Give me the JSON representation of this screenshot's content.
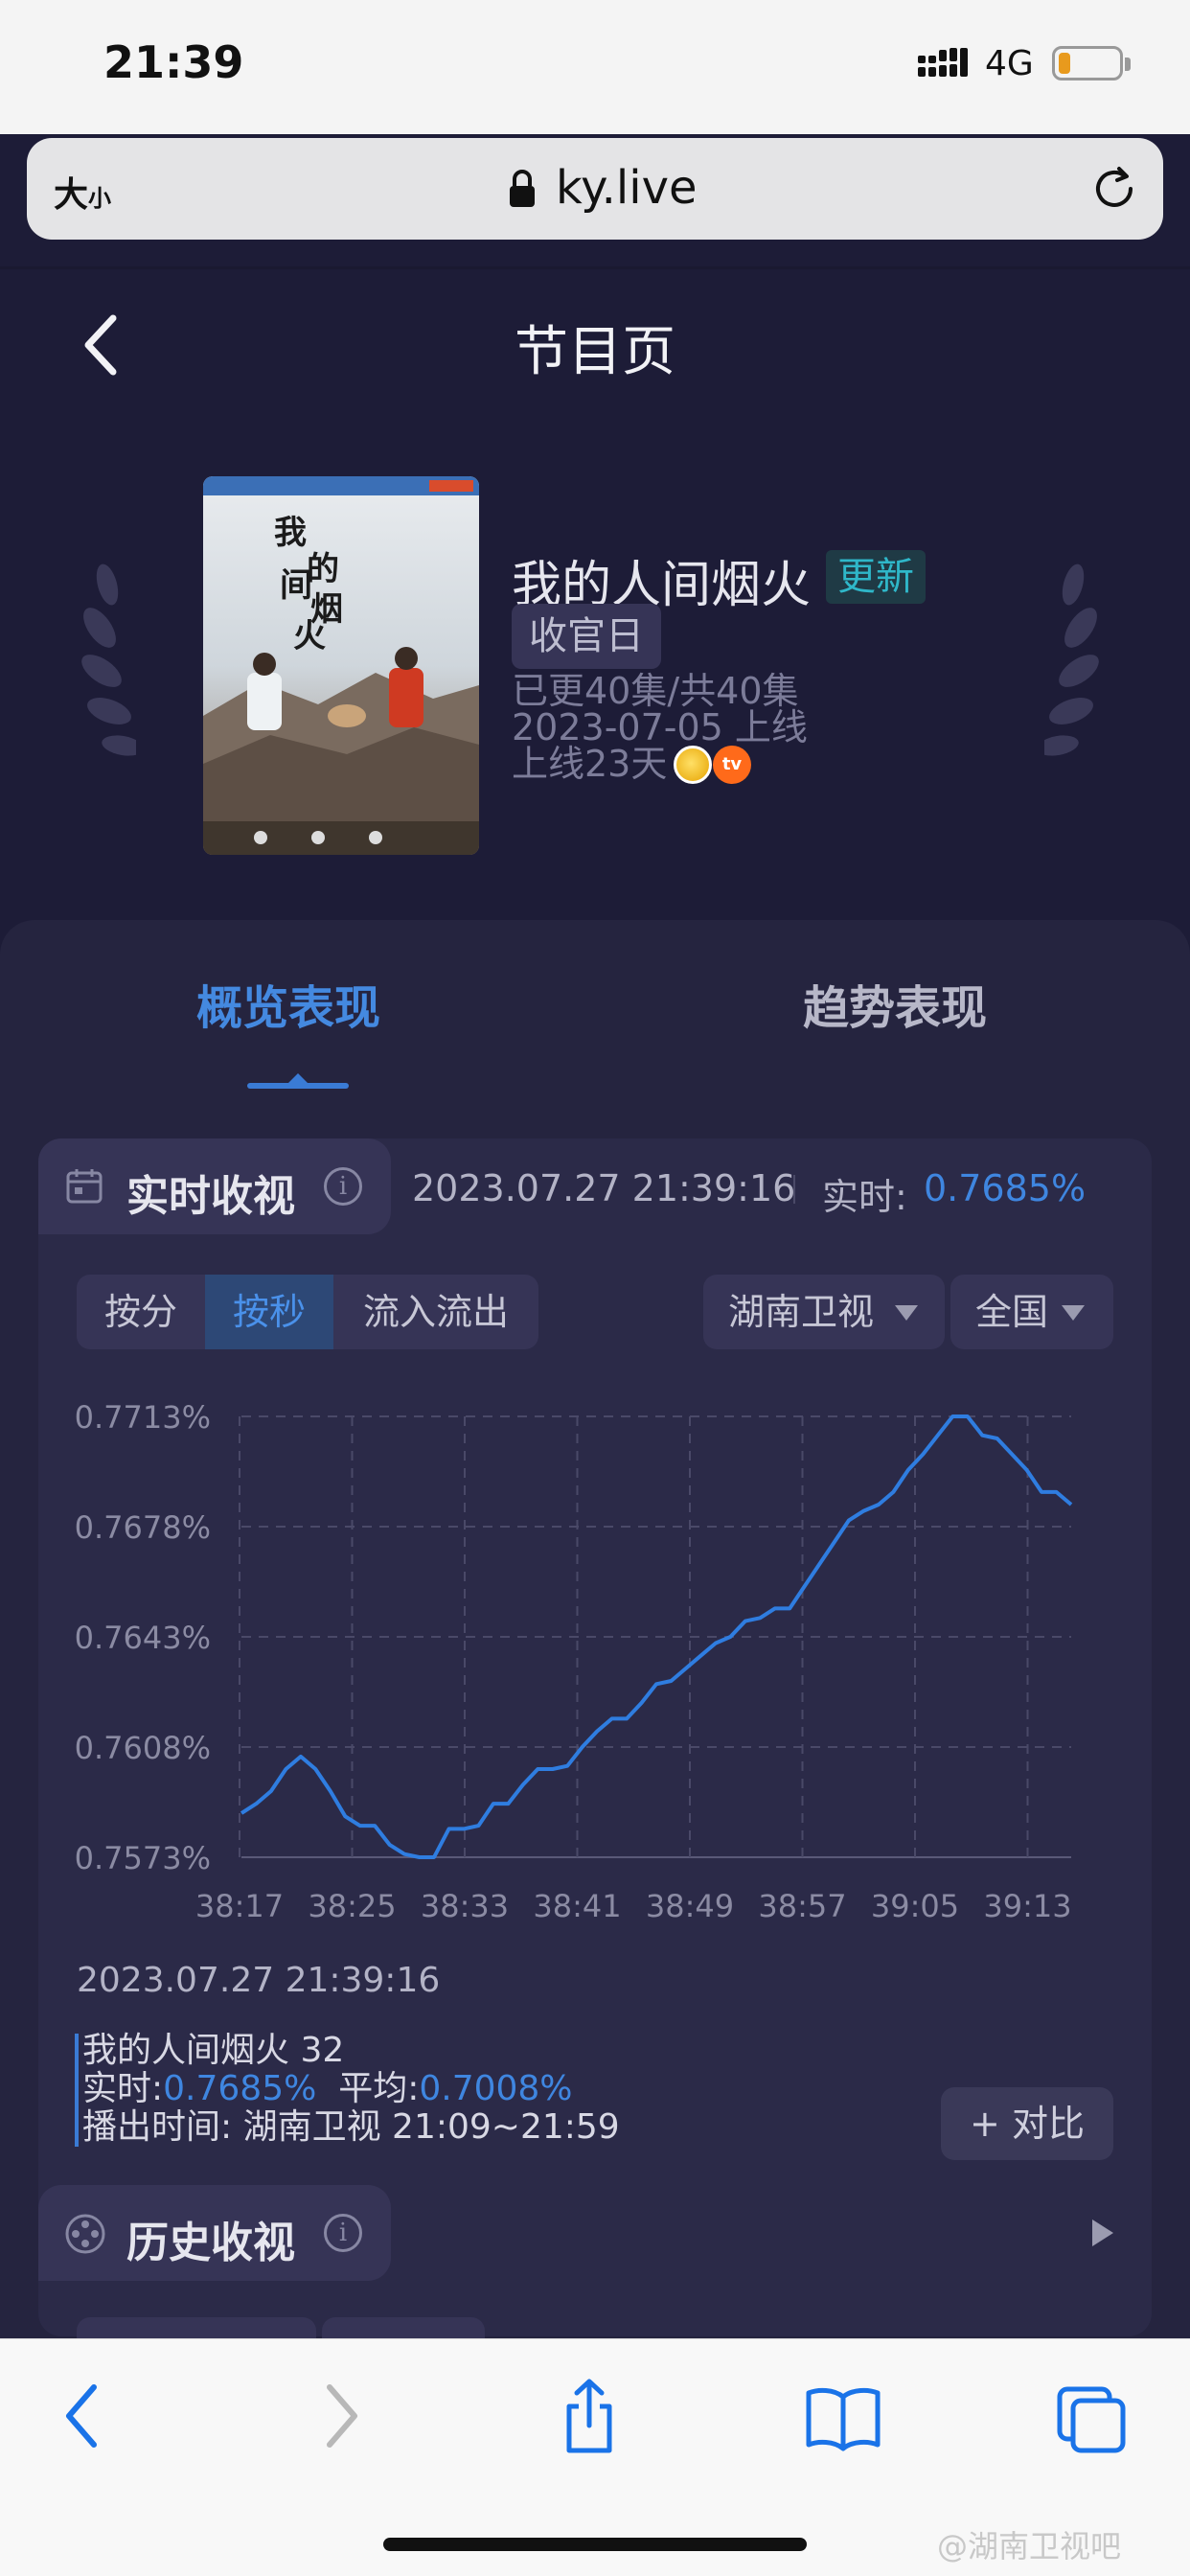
{
  "status_bar": {
    "time": "21:39",
    "network": "4G"
  },
  "url_bar": {
    "size_label": "大",
    "size_small": "小",
    "url": "ky.live"
  },
  "header": {
    "title": "节目页"
  },
  "program": {
    "title": "我的人间烟火",
    "badge": "更新",
    "tag": "收官日",
    "episodes": "已更40集/共40集",
    "launch_date": "2023-07-05 上线",
    "online_days": "上线23天",
    "poster_title": "我的人间烟火"
  },
  "tabs": [
    {
      "label": "概览表现",
      "active": true
    },
    {
      "label": "趋势表现",
      "active": false
    }
  ],
  "realtime": {
    "section_title": "实时收视",
    "timestamp": "2023.07.27 21:39:16",
    "label": "实时:",
    "value": "0.7685%"
  },
  "controls": {
    "segments": [
      {
        "label": "按分",
        "active": false
      },
      {
        "label": "按秒",
        "active": true
      },
      {
        "label": "流入流出",
        "active": false
      }
    ],
    "channel": "湖南卫视",
    "region": "全国"
  },
  "chart_data": {
    "type": "line",
    "x_ticks": [
      "38:17",
      "38:25",
      "38:33",
      "38:41",
      "38:49",
      "38:57",
      "39:05",
      "39:13"
    ],
    "y_ticks": [
      "0.7713%",
      "0.7678%",
      "0.7643%",
      "0.7608%",
      "0.7573%"
    ],
    "ylim": [
      0.7573,
      0.7713
    ],
    "grid": true,
    "x": [
      0,
      1.5,
      3,
      4,
      5,
      6,
      7,
      8,
      9,
      10,
      11,
      12,
      13,
      14,
      15,
      16,
      17,
      18,
      19,
      20,
      21,
      22,
      23,
      24,
      25,
      26,
      27,
      28,
      29,
      30,
      31,
      32,
      33,
      34,
      35,
      36,
      37,
      38,
      39,
      40,
      41,
      42,
      43,
      44,
      45,
      46,
      47,
      48,
      49,
      50,
      51,
      52,
      53,
      54,
      55,
      56,
      57,
      58,
      59,
      60,
      61,
      62,
      63,
      64
    ],
    "values": [
      0.7587,
      0.759,
      0.7594,
      0.7601,
      0.7605,
      0.7601,
      0.7594,
      0.7586,
      0.7583,
      0.7583,
      0.7577,
      0.7574,
      0.7573,
      0.7573,
      0.7582,
      0.7582,
      0.7583,
      0.759,
      0.759,
      0.7596,
      0.7601,
      0.7601,
      0.7602,
      0.7608,
      0.7613,
      0.7617,
      0.7617,
      0.7622,
      0.7628,
      0.7629,
      0.7633,
      0.7637,
      0.7641,
      0.7643,
      0.7648,
      0.7649,
      0.7652,
      0.7652,
      0.7659,
      0.7666,
      0.7673,
      0.768,
      0.7683,
      0.7685,
      0.7689,
      0.7696,
      0.7701,
      0.7707,
      0.7713,
      0.7713,
      0.7707,
      0.7706,
      0.7701,
      0.7696,
      0.7689,
      0.7689,
      0.7685
    ]
  },
  "detail": {
    "timestamp": "2023.07.27 21:39:16",
    "program_line": "我的人间烟火 32",
    "realtime_label": "实时:",
    "realtime_value": "0.7685%",
    "avg_label": "平均:",
    "avg_value": "0.7008%",
    "airtime_label": "播出时间:",
    "airtime_value": "湖南卫视 21:09~21:59"
  },
  "compare_button": "+ 对比",
  "history": {
    "section_title": "历史收视"
  },
  "watermark": "@湖南卫视吧",
  "colors": {
    "accent": "#3f86e0",
    "background": "#1d1c37",
    "card": "#25243f"
  }
}
